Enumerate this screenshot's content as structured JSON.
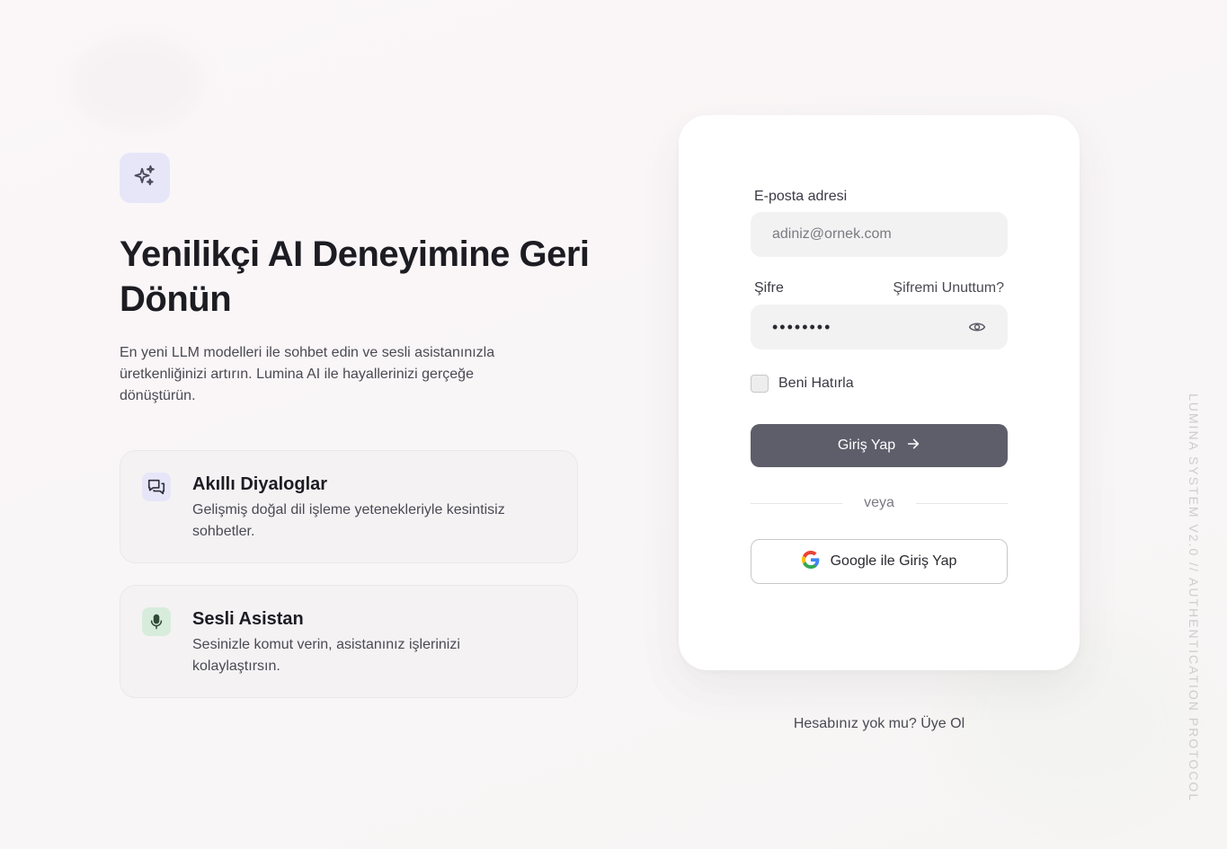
{
  "hero": {
    "title": "Yenilikçi AI Deneyimine Geri Dönün",
    "description": "En yeni LLM modelleri ile sohbet edin ve sesli asistanınızla üretkenliğinizi artırın. Lumina AI ile hayallerinizi gerçeğe dönüştürün.",
    "logo_icon": "sparkles-icon"
  },
  "features": [
    {
      "icon": "chat-bubbles-icon",
      "title": "Akıllı Diyaloglar",
      "description": "Gelişmiş doğal dil işleme yetenekleriyle kesintisiz sohbetler."
    },
    {
      "icon": "microphone-icon",
      "title": "Sesli Asistan",
      "description": "Sesinizle komut verin, asistanınız işlerinizi kolaylaştırsın."
    }
  ],
  "login": {
    "email_label": "E-posta adresi",
    "email_placeholder": "adiniz@ornek.com",
    "password_label": "Şifre",
    "forgot_password": "Şifremi Unuttum?",
    "password_value": "••••••••",
    "remember_me": "Beni Hatırla",
    "submit_label": "Giriş Yap",
    "divider_text": "veya",
    "google_label": "Google ile Giriş Yap"
  },
  "signup": {
    "prompt": "Hesabınız yok mu?",
    "link": "Üye Ol"
  },
  "footer": {
    "vertical_caption": "LUMINA SYSTEM V2.0 // AUTHENTICATION PROTOCOL"
  },
  "colors": {
    "primary_button": "#5e5e6b",
    "logo_tile": "#e6e6f8",
    "mic_tile": "#d8ecdc"
  }
}
